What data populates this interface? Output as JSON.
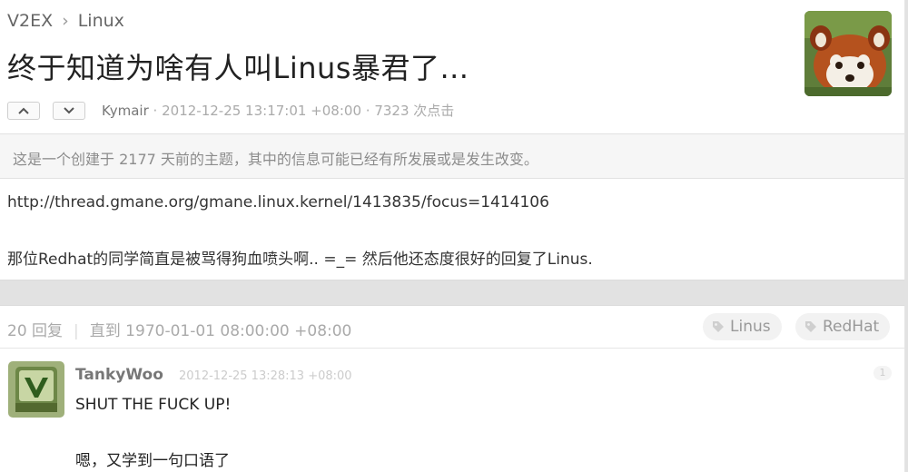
{
  "breadcrumb": {
    "site": "V2EX",
    "separator": "›",
    "node": "Linux"
  },
  "topic": {
    "title": "终于知道为啥有人叫Linus暴君了...",
    "author": "Kymair",
    "dot": "·",
    "created": "2012-12-25 13:17:01 +08:00",
    "clicks": "7323 次点击",
    "notice": "这是一个创建于 2177 天前的主题，其中的信息可能已经有所发展或是发生改变。",
    "content": [
      "http://thread.gmane.org/gmane.linux.kernel/1413835/focus=1414106",
      "那位Redhat的同学简直是被骂得狗血喷头啊.. =_= 然后他还态度很好的回复了Linus."
    ]
  },
  "vote": {
    "up_icon": "chevron-up-icon",
    "down_icon": "chevron-down-icon"
  },
  "replies_header": {
    "count": "20 回复",
    "divider": "|",
    "until": "直到 1970-01-01 08:00:00 +08:00"
  },
  "tags": [
    {
      "label": "Linus",
      "icon": "tag-icon"
    },
    {
      "label": "RedHat",
      "icon": "tag-icon"
    }
  ],
  "replies": [
    {
      "username": "TankyWoo",
      "time": "2012-12-25 13:28:13 +08:00",
      "floor": "1",
      "lines": [
        "SHUT THE FUCK UP!",
        "嗯，又学到一句口语了"
      ]
    }
  ],
  "colors": {
    "page_bg": "#e2e2e2",
    "box_bg": "#ffffff",
    "muted_text": "#aaaaaa"
  }
}
